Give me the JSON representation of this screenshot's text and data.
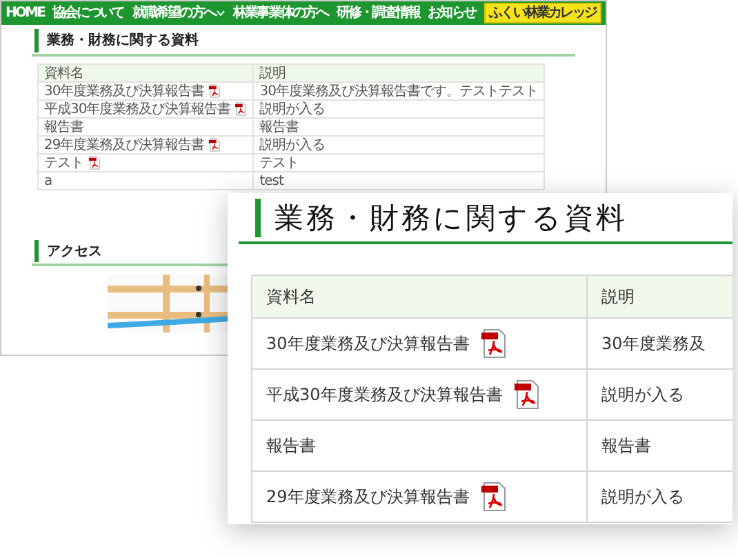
{
  "back_page": {
    "nav": [
      {
        "label": "HOME",
        "kind": "link"
      },
      {
        "label": "協会について",
        "kind": "link"
      },
      {
        "label": "就職希望の方へ",
        "kind": "dropdown"
      },
      {
        "label": "林業事業体の方へ",
        "kind": "link"
      },
      {
        "label": "研修・調査情報",
        "kind": "link"
      },
      {
        "label": "お知らせ",
        "kind": "link"
      },
      {
        "label": "ふくい林業カレッジ",
        "kind": "highlight"
      }
    ],
    "title": "業務・財務に関する資料",
    "table": {
      "columns": [
        "資料名",
        "説明"
      ],
      "rows": [
        {
          "name": "30年度業務及び決算報告書",
          "pdf": true,
          "description": "30年度業務及び決算報告書です。テストテスト"
        },
        {
          "name": "平成30年度業務及び決算報告書",
          "pdf": true,
          "description": "説明が入る"
        },
        {
          "name": "報告書",
          "pdf": false,
          "description": "報告書"
        },
        {
          "name": "29年度業務及び決算報告書",
          "pdf": true,
          "description": "説明が入る"
        },
        {
          "name": "テスト",
          "pdf": true,
          "description": "テスト"
        },
        {
          "name": "a",
          "pdf": false,
          "description": "test"
        }
      ]
    },
    "access_title": "アクセス"
  },
  "front_panel": {
    "title": "業務・財務に関する資料",
    "table": {
      "columns": [
        "資料名",
        "説明"
      ],
      "rows": [
        {
          "name": "30年度業務及び決算報告書",
          "pdf": true,
          "description": "30年度業務及"
        },
        {
          "name": "平成30年度業務及び決算報告書",
          "pdf": true,
          "description": "説明が入る"
        },
        {
          "name": "報告書",
          "pdf": false,
          "description": "報告書"
        },
        {
          "name": "29年度業務及び決算報告書",
          "pdf": true,
          "description": "説明が入る"
        }
      ]
    }
  }
}
